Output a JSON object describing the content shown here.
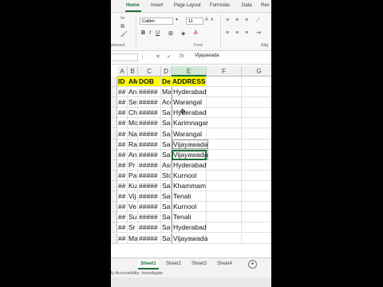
{
  "ribbon": {
    "tabs": [
      "Home",
      "Insert",
      "Page Layout",
      "Formulas",
      "Data",
      "Rev"
    ],
    "font_name": "Calibri",
    "font_size": "11",
    "clipboard_label": "pboard",
    "font_label": "Font",
    "alignment_label": "Alig"
  },
  "formula_bar": {
    "fx": "fx",
    "value": "Vijayawada"
  },
  "columns": [
    "A",
    "B",
    "C",
    "D",
    "E",
    "F",
    "G"
  ],
  "row_headers": [
    "",
    "",
    "",
    "",
    "",
    "",
    "",
    "",
    "",
    "",
    "",
    "",
    "",
    "",
    "",
    ""
  ],
  "header_row": [
    "ID",
    "AM",
    "DOB",
    "Desi",
    "ADDRESS"
  ],
  "rows": [
    [
      "##",
      "An",
      "#####",
      "Ma",
      "Hyderabad"
    ],
    [
      "##",
      "Sel",
      "#####",
      "Acc",
      "Warangal"
    ],
    [
      "##",
      "Ch",
      "#####",
      "Sal",
      "Hyderabad"
    ],
    [
      "##",
      "Mo",
      "#####",
      "Sal",
      "Karimnagar"
    ],
    [
      "##",
      "Na",
      "#####",
      "Sal",
      "Warangal"
    ],
    [
      "##",
      "Ra",
      "#####",
      "Sal",
      "Vijayawada"
    ],
    [
      "##",
      "An",
      "#####",
      "Sal",
      "Vijayawada"
    ],
    [
      "##",
      "Pr",
      "#####",
      "Ass",
      "Hyderabad"
    ],
    [
      "##",
      "Pa",
      "#####",
      "Sto",
      "Kurnool"
    ],
    [
      "##",
      "Ku",
      "#####",
      "Sal",
      "Khammam"
    ],
    [
      "##",
      "Vij",
      "#####",
      "Sal",
      "Tenali"
    ],
    [
      "##",
      "Ve",
      "#####",
      "Sal",
      "Kurnool"
    ],
    [
      "##",
      "Su",
      "#####",
      "Sal",
      "Tenali"
    ],
    [
      "##",
      "Sr",
      "#####",
      "Sal",
      "Hyderabad"
    ],
    [
      "##",
      "Ma",
      "#####",
      "Sal",
      "Vijayawada"
    ]
  ],
  "sheets": [
    "Sheet1",
    "Sheet2",
    "Sheet3",
    "Sheet4"
  ],
  "status": "fy    Accessibility: Investigate",
  "colors": {
    "accent": "#1f6f3d",
    "header_fill": "#ffff00"
  }
}
